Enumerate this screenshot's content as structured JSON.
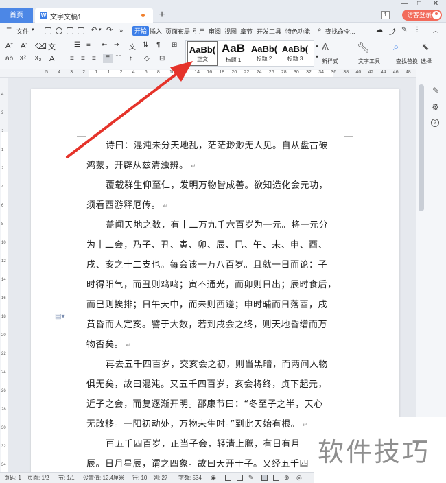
{
  "titlebar": {
    "home_tab": "首页",
    "doc_tab": "文字文稿1",
    "new_tab": "+",
    "window_count": "1",
    "visitor_login": "访客登录"
  },
  "menu": {
    "file": "文件",
    "items": [
      "开始",
      "插入",
      "页面布局",
      "引用",
      "审阅",
      "视图",
      "章节",
      "开发工具",
      "特色功能"
    ],
    "search": "查找命令..."
  },
  "ribbon": {
    "styles": [
      {
        "sample": "AaBb(",
        "caption": "正文"
      },
      {
        "sample": "AaB",
        "caption": "标题 1"
      },
      {
        "sample": "AaBb(",
        "caption": "标题 2"
      },
      {
        "sample": "AaBb(",
        "caption": "标题 3"
      }
    ],
    "new_style": "新样式",
    "text_tools": "文字工具",
    "find_replace": "查找替换",
    "select": "选择"
  },
  "ruler": {
    "h_numbers": [
      "5",
      "4",
      "3",
      "2",
      "1",
      "1",
      "2",
      "4",
      "6",
      "8",
      "10",
      "12",
      "14",
      "16",
      "18",
      "20",
      "22",
      "24",
      "26",
      "28",
      "30",
      "32",
      "34",
      "36",
      "38",
      "40",
      "42",
      "44",
      "46",
      "48"
    ],
    "v_numbers": [
      "4",
      "3",
      "2",
      "1",
      "2",
      "4",
      "6",
      "8",
      "10",
      "12",
      "14",
      "16",
      "18",
      "20",
      "22",
      "24",
      "26",
      "28",
      "30",
      "32",
      "34"
    ]
  },
  "document": {
    "paragraphs": [
      [
        "诗曰：混沌未分天地乱，茫茫渺渺无人见。自从盘古破",
        "鸿蒙，开辟从兹清浊辨。"
      ],
      [
        "覆载群生仰至仁，发明万物皆成善。欲知造化会元功，",
        "须看西游释厄传。"
      ],
      [
        "盖闻天地之数，有十二万九千六百岁为一元。将一元分",
        "为十二会，乃子、丑、寅、卯、辰、巳、午、未、申、酉、",
        "戌、亥之十二支也。每会该一万八百岁。且就一日而论：子",
        "时得阳气，而丑则鸡鸣；寅不通光，而卯则日出；辰时食后，",
        "而巳则挨排；日午天中，而未则西蹉；申时晡而日落酉，戌",
        "黄昏而人定亥。譬于大数，若到戌会之终，则天地昏缯而万",
        "物否矣。"
      ],
      [
        "再去五千四百岁，交亥会之初，则当黑暗，而两间人物",
        "俱无矣，故曰混沌。又五千四百岁，亥会将终，贞下起元，",
        "近子之会，而复逐渐开明。邵康节曰：“冬至子之半，天心",
        "无改移。一阳初动处，万物未生时。”到此天始有根。"
      ],
      [
        "再五千四百岁，正当子会，轻清上腾，有日有月",
        "辰。日月星辰，谓之四象。故曰天开于子。又经五千四"
      ]
    ],
    "paragraph_mark": "↵"
  },
  "status": {
    "page_no": "页码: 1",
    "pages": "页面: 1/2",
    "section": "节: 1/1",
    "set_value": "设置值: 12.4厘米",
    "row": "行: 10",
    "col": "列: 27",
    "words": "字数: 534"
  },
  "watermark": "软件技巧",
  "colors": {
    "accent": "#3d7fe8",
    "login": "#f26b5b",
    "annotation_arrow": "#e5332a"
  }
}
